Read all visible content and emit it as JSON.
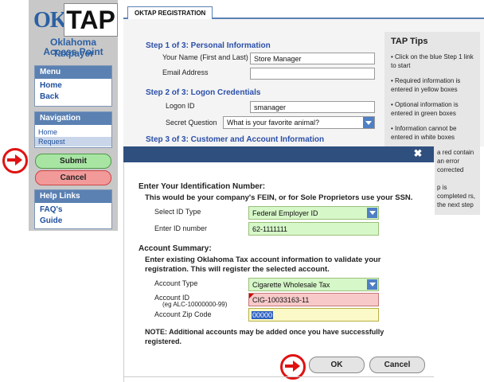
{
  "logo": {
    "ok": "OK",
    "tap": "TAP",
    "line1": "Oklahoma Taxpayer",
    "line2": "Access Point"
  },
  "sidebar": {
    "menu": {
      "title": "Menu",
      "items": [
        "Home",
        "Back"
      ]
    },
    "navigation": {
      "title": "Navigation",
      "items": [
        "Home",
        "Request"
      ]
    },
    "submit_label": "Submit",
    "cancel_label": "Cancel",
    "help": {
      "title": "Help Links",
      "items": [
        "FAQ's",
        "Guide"
      ]
    }
  },
  "page": {
    "tab": "OKTAP REGISTRATION",
    "step1": {
      "title": "Step 1 of 3: Personal Information",
      "name_label": "Your Name (First and Last)",
      "name_value": "Store Manager",
      "email_label": "Email Address",
      "email_value": ""
    },
    "step2": {
      "title": "Step 2 of 3: Logon Credentials",
      "logon_label": "Logon ID",
      "logon_value": "smanager",
      "question_label": "Secret Question",
      "question_value": "What is your favorite animal?"
    },
    "step3": {
      "title": "Step 3 of 3: Customer and Account Information"
    }
  },
  "tips": {
    "title": "TAP Tips",
    "items": [
      "• Click on the blue Step 1 link to start",
      "• Required information is entered in yellow boxes",
      "• Optional information is entered in green boxes",
      "• Information cannot be entered in white boxes",
      "a red contain an error corrected",
      "p is completed rs, the next step"
    ]
  },
  "modal": {
    "close_glyph": "✖",
    "id_heading": "Enter Your Identification Number:",
    "id_sub": "This would be your company's FEIN, or for Sole Proprietors use your SSN.",
    "id_type_label": "Select ID Type",
    "id_type_value": "Federal Employer ID",
    "id_number_label": "Enter ID number",
    "id_number_value": "62-1111111",
    "summary_heading": "Account Summary:",
    "summary_text_1": "Enter existing Oklahoma Tax account information to validate your",
    "summary_text_2": "registration. This will register the selected account.",
    "account_type_label": "Account Type",
    "account_type_value": "Cigarette Wholesale Tax",
    "account_id_label": "Account ID",
    "account_id_hint": "(eg ALC-10000000-99)",
    "account_id_value": "CIG-10033163-11",
    "zip_label": "Account Zip Code",
    "zip_value": "00000",
    "note_1": "NOTE: Additional accounts may be added once you have successfully",
    "note_2": "registered.",
    "ok_label": "OK",
    "cancel_label": "Cancel"
  },
  "colors": {
    "accent": "#2b4fa8",
    "highlight_ring": "#e01212",
    "required": "#fbf9c7",
    "optional": "#d6f7c8",
    "error": "#f8c9c9"
  }
}
